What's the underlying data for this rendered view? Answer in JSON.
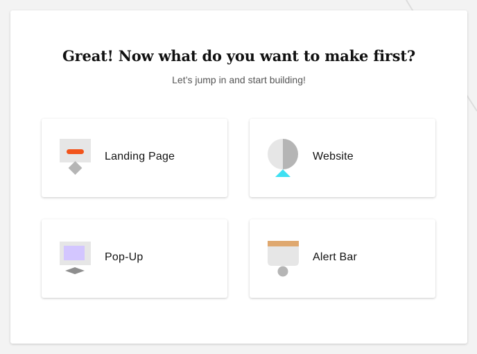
{
  "heading": {
    "title": "Great! Now what do you want to make first?",
    "subtitle": "Let’s jump in and start building!"
  },
  "options": [
    {
      "label": "Landing Page",
      "icon": "landing-page-icon"
    },
    {
      "label": "Website",
      "icon": "website-icon"
    },
    {
      "label": "Pop-Up",
      "icon": "popup-icon"
    },
    {
      "label": "Alert Bar",
      "icon": "alert-bar-icon"
    }
  ],
  "colors": {
    "background": "#f3f3f3",
    "panel": "#ffffff",
    "icon_gray": "#e6e6e6",
    "icon_mid_gray": "#b5b5b5",
    "accent_orange": "#f2541b",
    "accent_cyan": "#3ee0f2",
    "accent_lavender": "#d3c6ff",
    "accent_tan": "#dfa86f"
  }
}
